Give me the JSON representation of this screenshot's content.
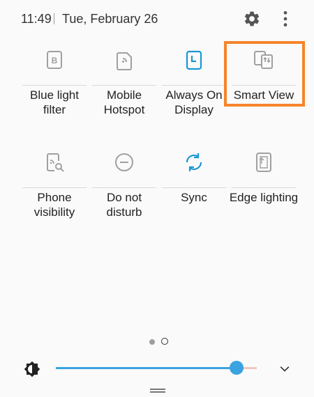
{
  "status": {
    "time": "11:49",
    "date": "Tue, February 26"
  },
  "tiles": [
    {
      "label": "Blue light filter",
      "icon": "blue-light-filter-icon",
      "active": false
    },
    {
      "label": "Mobile Hotspot",
      "icon": "mobile-hotspot-icon",
      "active": false
    },
    {
      "label": "Always On Display",
      "icon": "always-on-display-icon",
      "active": true
    },
    {
      "label": "Smart View",
      "icon": "smart-view-icon",
      "active": false
    },
    {
      "label": "Phone visibility",
      "icon": "phone-visibility-icon",
      "active": false
    },
    {
      "label": "Do not disturb",
      "icon": "do-not-disturb-icon",
      "active": false
    },
    {
      "label": "Sync",
      "icon": "sync-icon",
      "active": true
    },
    {
      "label": "Edge lighting",
      "icon": "edge-lighting-icon",
      "active": false
    }
  ],
  "brightness": {
    "level": 0.9
  },
  "pages": {
    "current": 1,
    "total": 2
  },
  "colors": {
    "accent": "#1a96d6",
    "inactive_icon": "#9e9e9e",
    "highlight": "#f5852b",
    "slider": "#3aa3e0"
  }
}
